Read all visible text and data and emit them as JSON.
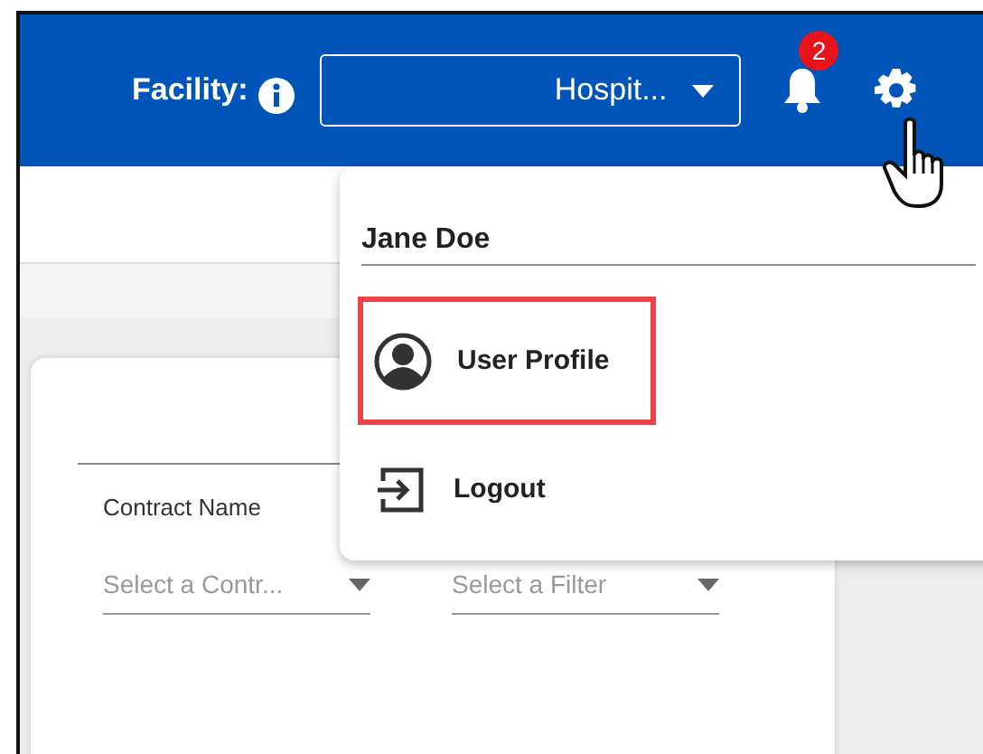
{
  "header": {
    "facility_label": "Facility:",
    "facility_select": {
      "value": "Hospit..."
    },
    "notifications": {
      "count": "2"
    }
  },
  "user_menu": {
    "user_name": "Jane Doe",
    "items": [
      {
        "kind": "profile",
        "label": "User Profile",
        "highlighted": true
      },
      {
        "kind": "logout",
        "label": "Logout",
        "highlighted": false
      }
    ]
  },
  "filters": {
    "contract_label": "Contract Name",
    "dropdowns": [
      {
        "placeholder": "Select a Contr..."
      },
      {
        "placeholder": "Select a Filter"
      }
    ]
  }
}
